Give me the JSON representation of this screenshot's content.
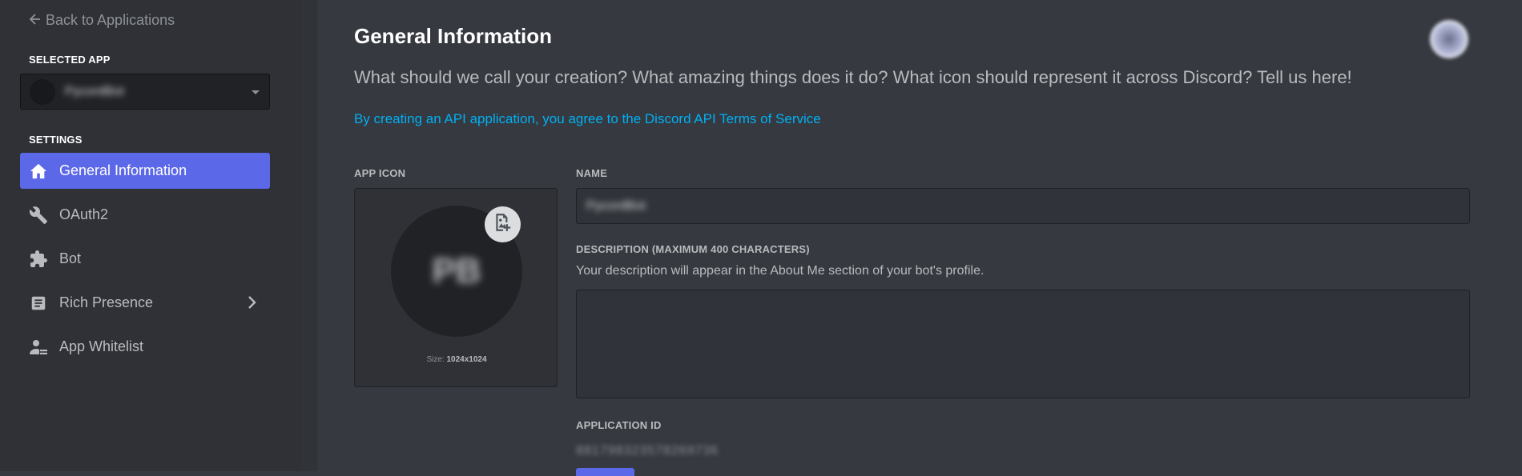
{
  "sidebar": {
    "back_label": "Back to Applications",
    "selected_app_label": "SELECTED APP",
    "selected_app_name": "PycordBot",
    "settings_label": "SETTINGS",
    "items": [
      {
        "label": "General Information",
        "icon": "home-icon"
      },
      {
        "label": "OAuth2",
        "icon": "wrench-icon"
      },
      {
        "label": "Bot",
        "icon": "puzzle-icon"
      },
      {
        "label": "Rich Presence",
        "icon": "document-icon"
      },
      {
        "label": "App Whitelist",
        "icon": "user-list-icon"
      }
    ]
  },
  "main": {
    "title": "General Information",
    "subtitle": "What should we call your creation? What amazing things does it do? What icon should represent it across Discord? Tell us here!",
    "tos_link": "By creating an API application, you agree to the Discord API Terms of Service",
    "app_icon_label": "APP ICON",
    "app_icon_initials": "PB",
    "size_prefix": "Size:",
    "size_value": "1024x1024",
    "name_label": "NAME",
    "name_value": "PycordBot",
    "description_label": "DESCRIPTION (MAXIMUM 400 CHARACTERS)",
    "description_hint": "Your description will appear in the About Me section of your bot's profile.",
    "description_value": "",
    "application_id_label": "APPLICATION ID",
    "application_id_value": "881798323578269736"
  },
  "colors": {
    "accent": "#5b68e7",
    "link": "#00b0f4",
    "sidebar_bg": "#2f3136",
    "main_bg": "#36393f"
  }
}
